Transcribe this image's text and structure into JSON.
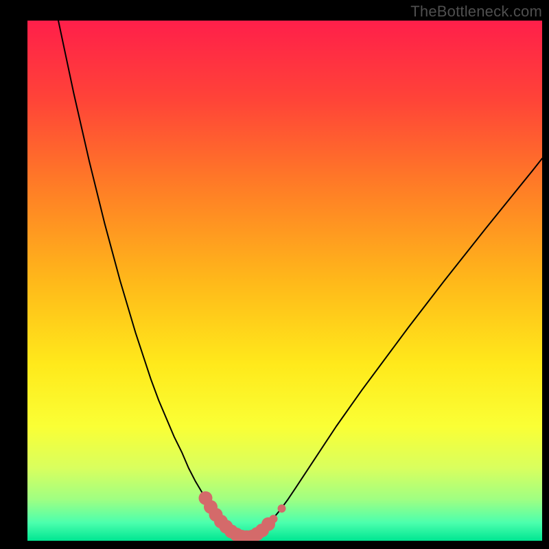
{
  "watermark": "TheBottleneck.com",
  "chart_data": {
    "type": "line",
    "title": "",
    "xlabel": "",
    "ylabel": "",
    "xlim": [
      0,
      100
    ],
    "ylim": [
      0,
      100
    ],
    "grid": false,
    "legend": false,
    "background_gradient": {
      "stops": [
        {
          "offset": 0.0,
          "color": "#ff1f4a"
        },
        {
          "offset": 0.15,
          "color": "#ff4338"
        },
        {
          "offset": 0.32,
          "color": "#ff7d26"
        },
        {
          "offset": 0.5,
          "color": "#ffb81a"
        },
        {
          "offset": 0.66,
          "color": "#ffe91b"
        },
        {
          "offset": 0.78,
          "color": "#faff35"
        },
        {
          "offset": 0.86,
          "color": "#d9ff5e"
        },
        {
          "offset": 0.92,
          "color": "#a0ff82"
        },
        {
          "offset": 0.965,
          "color": "#4cffad"
        },
        {
          "offset": 1.0,
          "color": "#00e692"
        }
      ]
    },
    "series": [
      {
        "name": "curve",
        "stroke": "#000000",
        "stroke_width": 2,
        "x": [
          6.0,
          7.5,
          9.0,
          10.5,
          12.0,
          13.5,
          15.0,
          16.5,
          18.0,
          19.5,
          21.0,
          22.5,
          24.0,
          25.5,
          27.0,
          28.5,
          30.0,
          31.3,
          32.6,
          33.8,
          35.0,
          36.0,
          37.0,
          38.0,
          39.0,
          40.0,
          41.0,
          42.0,
          43.0,
          44.0,
          45.0,
          46.0,
          47.5,
          49.0,
          50.5,
          52.0,
          54.0,
          56.0,
          58.0,
          60.0,
          62.5,
          65.0,
          68.0,
          71.0,
          74.0,
          77.5,
          81.0,
          85.0,
          89.0,
          93.5,
          98.0,
          100.0
        ],
        "y": [
          100.0,
          93.0,
          86.0,
          79.5,
          73.0,
          67.0,
          61.0,
          55.5,
          50.0,
          45.0,
          40.0,
          35.5,
          31.0,
          27.0,
          23.5,
          20.0,
          17.0,
          14.0,
          11.5,
          9.5,
          7.5,
          6.0,
          4.5,
          3.3,
          2.3,
          1.5,
          1.0,
          0.7,
          0.7,
          1.0,
          1.7,
          2.6,
          4.0,
          5.8,
          7.8,
          10.0,
          13.0,
          16.0,
          19.0,
          22.0,
          25.5,
          29.0,
          33.0,
          37.0,
          41.0,
          45.5,
          50.0,
          55.0,
          60.0,
          65.5,
          71.0,
          73.5
        ]
      },
      {
        "name": "trough-markers",
        "stroke": "#d46a6a",
        "marker": "circle",
        "marker_radius_large": 10,
        "marker_radius_small": 6,
        "points": [
          {
            "x": 34.6,
            "y": 8.2,
            "r": "large"
          },
          {
            "x": 35.6,
            "y": 6.5,
            "r": "large"
          },
          {
            "x": 36.6,
            "y": 5.0,
            "r": "large"
          },
          {
            "x": 37.6,
            "y": 3.7,
            "r": "large"
          },
          {
            "x": 38.6,
            "y": 2.7,
            "r": "large"
          },
          {
            "x": 39.6,
            "y": 1.8,
            "r": "large"
          },
          {
            "x": 40.6,
            "y": 1.2,
            "r": "large"
          },
          {
            "x": 41.6,
            "y": 0.8,
            "r": "large"
          },
          {
            "x": 42.6,
            "y": 0.7,
            "r": "large"
          },
          {
            "x": 43.6,
            "y": 0.8,
            "r": "large"
          },
          {
            "x": 44.6,
            "y": 1.3,
            "r": "large"
          },
          {
            "x": 45.6,
            "y": 2.0,
            "r": "large"
          },
          {
            "x": 46.8,
            "y": 3.2,
            "r": "large"
          },
          {
            "x": 47.8,
            "y": 4.2,
            "r": "small"
          },
          {
            "x": 49.4,
            "y": 6.2,
            "r": "small"
          }
        ]
      }
    ]
  }
}
